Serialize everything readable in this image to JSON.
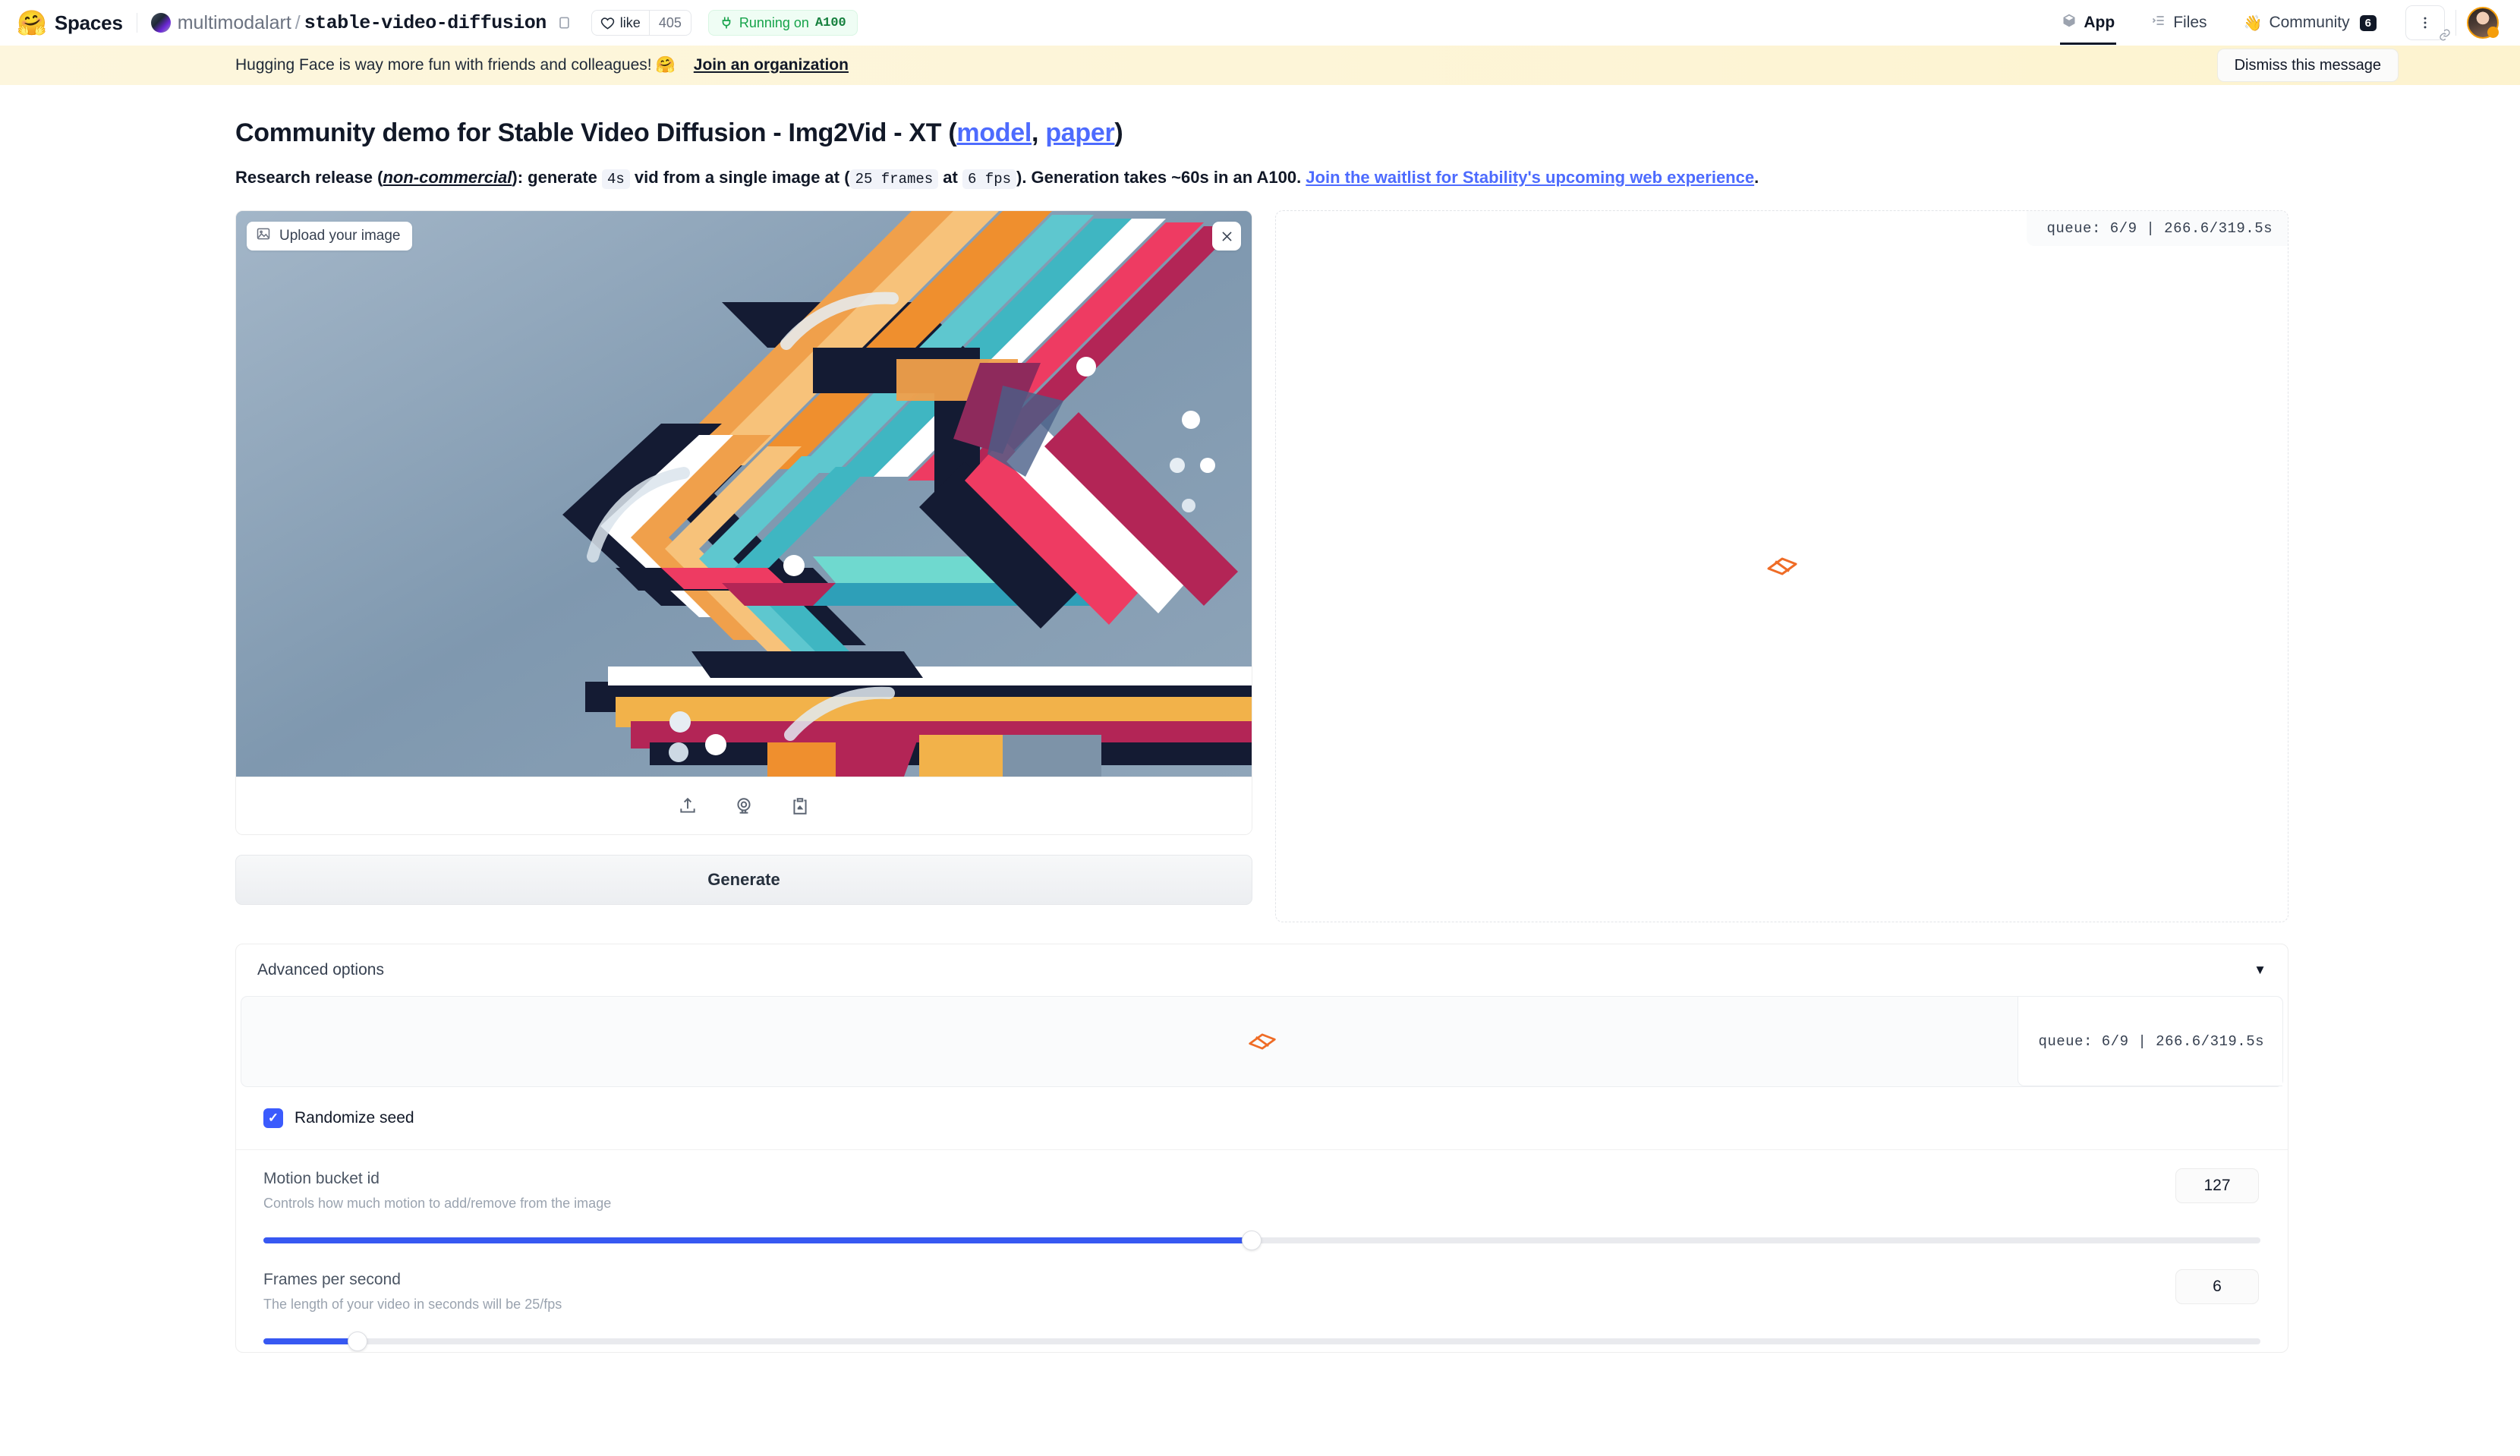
{
  "nav": {
    "logo_icon": "hugging-face-emoji",
    "spaces_label": "Spaces",
    "org": "multimodalart",
    "slash": "/",
    "repo": "stable-video-diffusion",
    "copy_icon": "copy-icon",
    "like_label": "like",
    "like_count": "405",
    "status_prefix": "Running on",
    "status_hardware": "A100",
    "tabs": [
      {
        "label": "App",
        "icon": "cube-icon",
        "active": true
      },
      {
        "label": "Files",
        "icon": "files-icon",
        "active": false
      },
      {
        "label": "Community",
        "icon": "wave-emoji",
        "badge": "6",
        "active": false
      }
    ],
    "kebab_icon": "kebab-menu-icon",
    "link_icon": "link-icon",
    "avatar": "user-avatar"
  },
  "banner": {
    "message": "Hugging Face is way more fun with friends and colleagues!",
    "emoji": "🤗",
    "link": "Join an organization",
    "dismiss": "Dismiss this message",
    "bg_color": "#fdf5d8"
  },
  "main": {
    "title_prefix": "Community demo for Stable Video Diffusion - Img2Vid - XT (",
    "title_link_model": "model",
    "title_comma": ", ",
    "title_link_paper": "paper",
    "title_suffix": ")",
    "sub_1": "Research release (",
    "sub_noncommercial": "non-commercial",
    "sub_2": "): generate ",
    "sub_dur": "4s",
    "sub_3": " vid from a single image at (",
    "sub_frames": "25 frames",
    "sub_at": " at ",
    "sub_fps": "6 fps",
    "sub_4": "). Generation takes ~60s in an A100. ",
    "sub_link": "Join the waitlist for Stability's upcoming web experience",
    "sub_end": "."
  },
  "input_panel": {
    "upload_chip": "Upload your image",
    "upload_chip_icon": "image-placeholder-icon",
    "close_icon": "close-icon",
    "toolbar_icons": [
      "upload-icon",
      "webcam-icon",
      "paste-clipboard-icon"
    ],
    "generate_label": "Generate"
  },
  "output_panel": {
    "queue_status": "queue: 6/9  |  266.6/319.5s",
    "spinner_icon": "gradio-loading-icon"
  },
  "advanced": {
    "header": "Advanced options",
    "caret_icon": "chevron-down-icon",
    "queue_status": "queue: 6/9  |  266.6/319.5s",
    "spinner_icon": "gradio-loading-icon",
    "randomize_seed_label": "Randomize seed",
    "randomize_seed_checked": true,
    "sliders": [
      {
        "label": "Motion bucket id",
        "desc": "Controls how much motion to add/remove from the image",
        "value": "127",
        "fill_pct": 49.5
      },
      {
        "label": "Frames per second",
        "desc": "The length of your video in seconds will be 25/fps",
        "value": "6",
        "fill_pct": 4.7
      }
    ]
  },
  "colors": {
    "accent_blue": "#3758f2",
    "link_blue": "#4d6bfe",
    "green": "#16a34a",
    "banner": "#fdf5d8"
  }
}
